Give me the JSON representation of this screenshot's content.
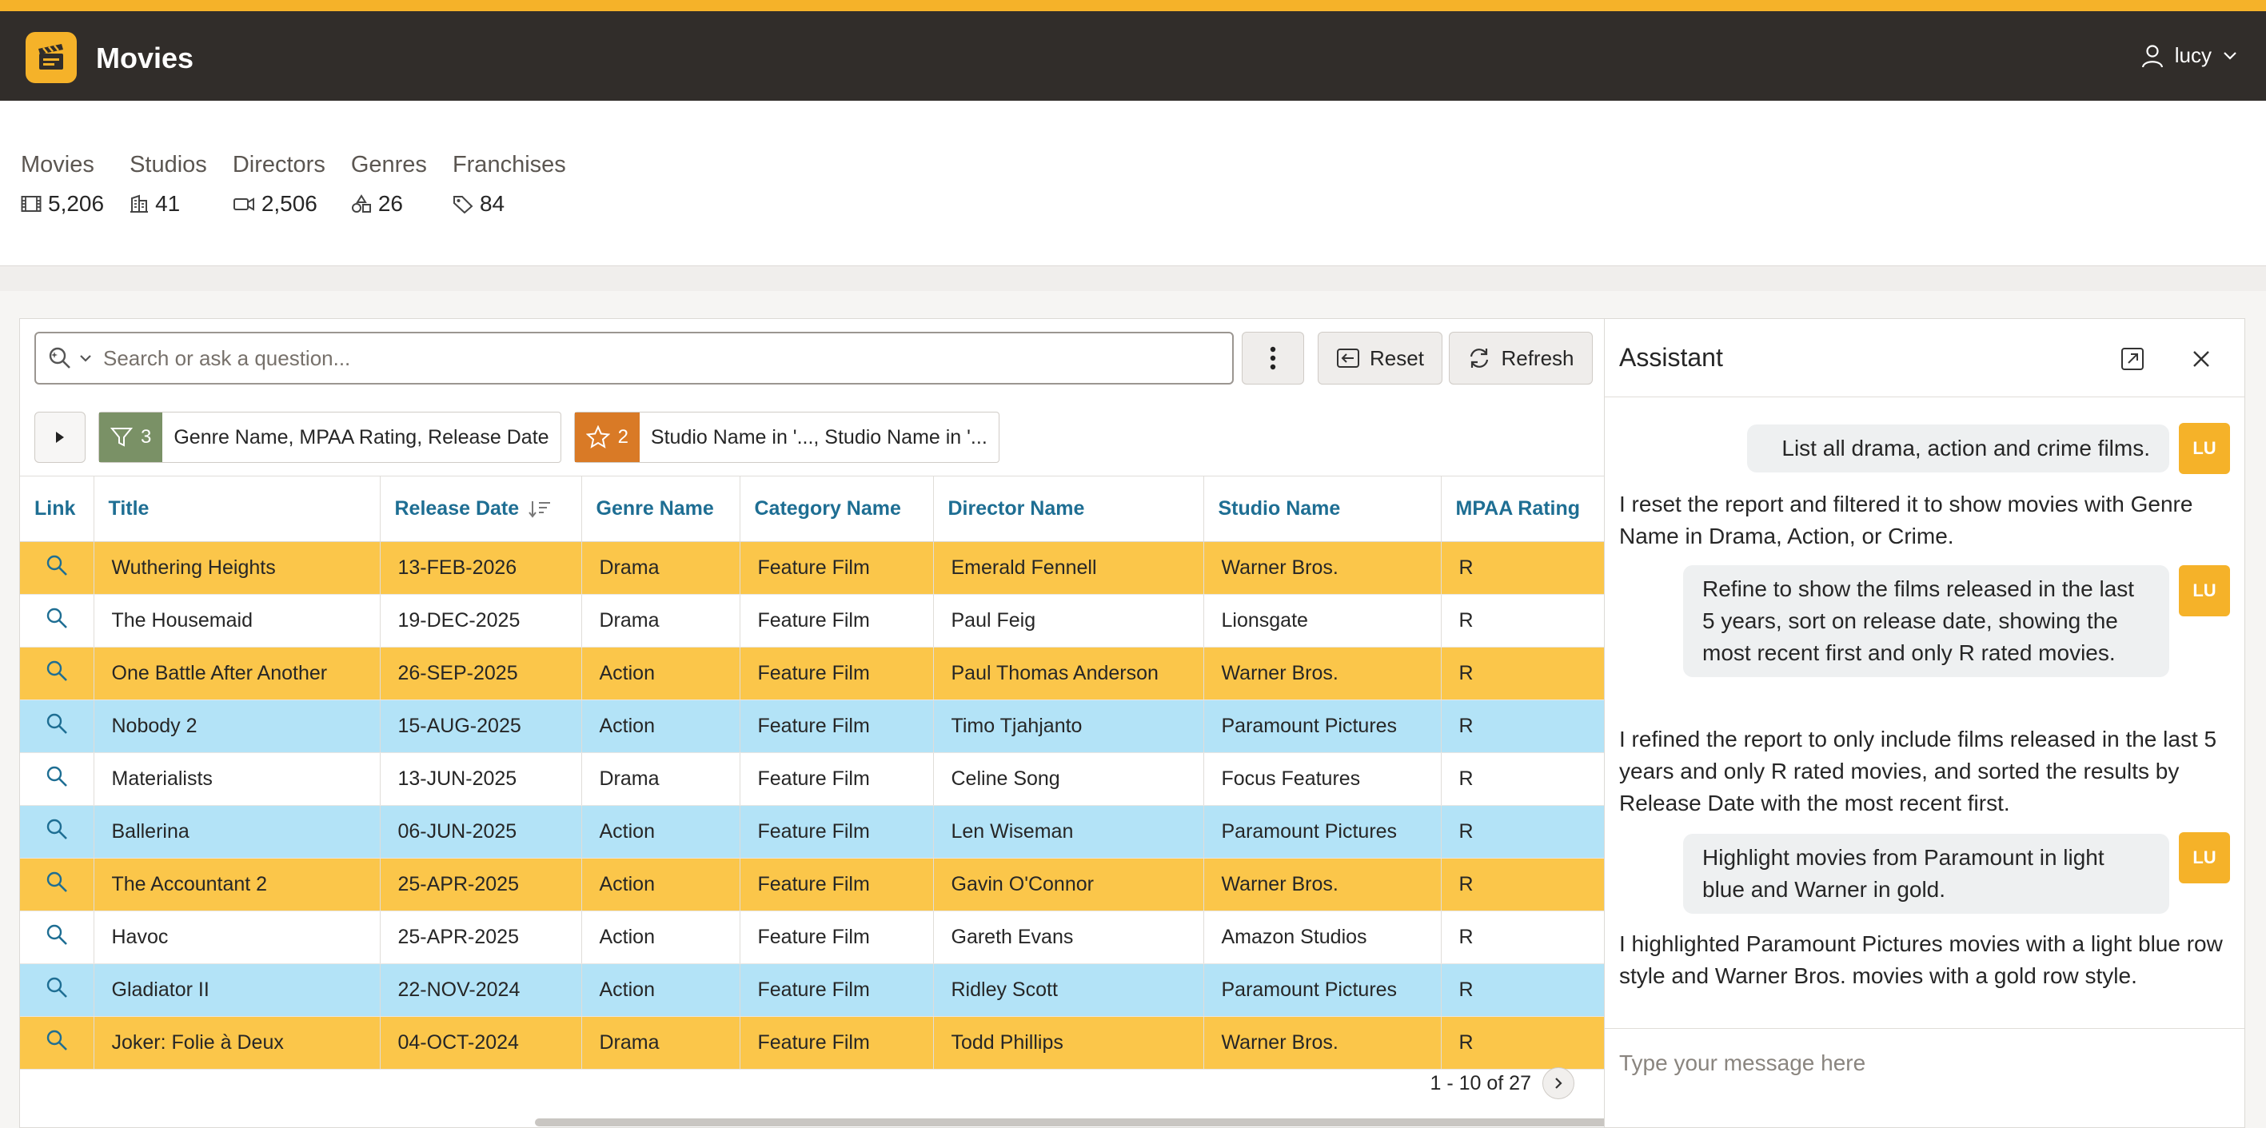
{
  "app": {
    "title": "Movies",
    "logo_icon": "clapperboard-icon",
    "accent_color": "#f5b229",
    "header_color": "#312d2a"
  },
  "user": {
    "name": "lucy"
  },
  "stats": [
    {
      "label": "Movies",
      "value": "5,206",
      "icon": "film-icon"
    },
    {
      "label": "Studios",
      "value": "41",
      "icon": "building-icon"
    },
    {
      "label": "Directors",
      "value": "2,506",
      "icon": "camera-icon"
    },
    {
      "label": "Genres",
      "value": "26",
      "icon": "shapes-icon"
    },
    {
      "label": "Franchises",
      "value": "84",
      "icon": "tag-icon"
    }
  ],
  "toolbar": {
    "search_placeholder": "Search or ask a question...",
    "reset_label": "Reset",
    "refresh_label": "Refresh"
  },
  "filters": [
    {
      "kind": "filter",
      "count": "3",
      "text": "Genre Name, MPAA Rating, Release Date",
      "color": "#7a9166"
    },
    {
      "kind": "highlight",
      "count": "2",
      "text": "Studio Name in '..., Studio Name in '...",
      "color": "#d97a26"
    }
  ],
  "table": {
    "headers": [
      "Link",
      "Title",
      "Release Date",
      "Genre Name",
      "Category Name",
      "Director Name",
      "Studio Name",
      "MPAA Rating"
    ],
    "sorted_column": "Release Date",
    "sort_direction": "descending",
    "row_colors": {
      "gold": "#fbc64a",
      "blue": "#b3e3f7",
      "none": "#ffffff"
    },
    "rows": [
      {
        "highlight": "gold",
        "cells": [
          "Wuthering Heights",
          "13-FEB-2026",
          "Drama",
          "Feature Film",
          "Emerald Fennell",
          "Warner Bros.",
          "R"
        ]
      },
      {
        "highlight": "none",
        "cells": [
          "The Housemaid",
          "19-DEC-2025",
          "Drama",
          "Feature Film",
          "Paul Feig",
          "Lionsgate",
          "R"
        ]
      },
      {
        "highlight": "gold",
        "cells": [
          "One Battle After Another",
          "26-SEP-2025",
          "Action",
          "Feature Film",
          "Paul Thomas Anderson",
          "Warner Bros.",
          "R"
        ]
      },
      {
        "highlight": "blue",
        "cells": [
          "Nobody 2",
          "15-AUG-2025",
          "Action",
          "Feature Film",
          "Timo Tjahjanto",
          "Paramount Pictures",
          "R"
        ]
      },
      {
        "highlight": "none",
        "cells": [
          "Materialists",
          "13-JUN-2025",
          "Drama",
          "Feature Film",
          "Celine Song",
          "Focus Features",
          "R"
        ]
      },
      {
        "highlight": "blue",
        "cells": [
          "Ballerina",
          "06-JUN-2025",
          "Action",
          "Feature Film",
          "Len Wiseman",
          "Paramount Pictures",
          "R"
        ]
      },
      {
        "highlight": "gold",
        "cells": [
          "The Accountant 2",
          "25-APR-2025",
          "Action",
          "Feature Film",
          "Gavin O'Connor",
          "Warner Bros.",
          "R"
        ]
      },
      {
        "highlight": "none",
        "cells": [
          "Havoc",
          "25-APR-2025",
          "Action",
          "Feature Film",
          "Gareth Evans",
          "Amazon Studios",
          "R"
        ]
      },
      {
        "highlight": "blue",
        "cells": [
          "Gladiator II",
          "22-NOV-2024",
          "Action",
          "Feature Film",
          "Ridley Scott",
          "Paramount Pictures",
          "R"
        ]
      },
      {
        "highlight": "gold",
        "cells": [
          "Joker: Folie à Deux",
          "04-OCT-2024",
          "Drama",
          "Feature Film",
          "Todd Phillips",
          "Warner Bros.",
          "R"
        ]
      }
    ],
    "pagination": "1 - 10 of 27"
  },
  "assistant": {
    "title": "Assistant",
    "avatar_initials": "LU",
    "messages": [
      {
        "role": "user",
        "text": "List all drama, action and crime films."
      },
      {
        "role": "assistant",
        "text": "I reset the report and filtered it to show movies with Genre Name in Drama, Action, or Crime."
      },
      {
        "role": "user",
        "text": "Refine to show the films released in the last 5 years, sort on release date, showing the most recent first and only R rated movies."
      },
      {
        "role": "assistant",
        "text": "I refined the report to only include films released in the last 5 years and only R rated movies, and sorted the results by Release Date with the most recent first."
      },
      {
        "role": "user",
        "text": "Highlight movies from Paramount in light blue and Warner in gold."
      },
      {
        "role": "assistant",
        "text": "I highlighted Paramount Pictures movies with a light blue row style and Warner Bros. movies with a gold row style."
      }
    ],
    "input_placeholder": "Type your message here"
  }
}
